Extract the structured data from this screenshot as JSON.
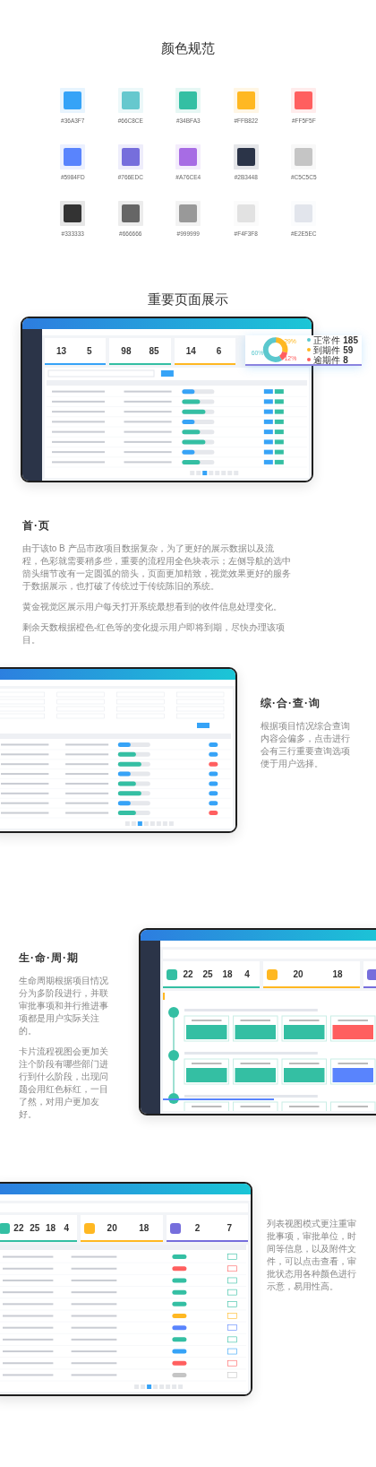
{
  "color_spec": {
    "title": "颜色规范",
    "swatches": [
      {
        "label": "#36A3F7",
        "color": "#36a3f7"
      },
      {
        "label": "#66C8CE",
        "color": "#66c8ce"
      },
      {
        "label": "#34BFA3",
        "color": "#34bfa3"
      },
      {
        "label": "#FFB822",
        "color": "#ffb822"
      },
      {
        "label": "#FF5F5F",
        "color": "#ff5f5f"
      },
      {
        "label": "#5984FD",
        "color": "#5984fd"
      },
      {
        "label": "#766EDC",
        "color": "#766edc"
      },
      {
        "label": "#A76CE4",
        "color": "#a76ce4"
      },
      {
        "label": "#2B3448",
        "color": "#2b3448"
      },
      {
        "label": "#C5C5C5",
        "color": "#c5c5c5"
      },
      {
        "label": "#333333",
        "color": "#333333"
      },
      {
        "label": "#666666",
        "color": "#666666"
      },
      {
        "label": "#999999",
        "color": "#999999"
      },
      {
        "label": "#F4F3F8",
        "color": "#e2e2e2"
      },
      {
        "label": "#E2E5EC",
        "color": "#e2e5ec"
      }
    ]
  },
  "showcase": {
    "title": "重要页面展示"
  },
  "sections": [
    {
      "kind": "dashboard",
      "heading": "首·页",
      "paragraphs": [
        "由于该to B 产品市政项目数据复杂，为了更好的展示数据以及流程，色彩就需要稍多些，重要的流程用全色块表示；左侧导航的选中箭头细节改有一定圆弧的箭头，页面更加精致，视觉效果更好的服务于数据展示，也打破了传统过于传统陈旧的系统。",
        "黄金视觉区展示用户每天打开系统最想看到的收件信息处理变化。",
        "剩余天数根据橙色-红色等的变化提示用户即将到期，尽快办理该项目。"
      ],
      "mock": {
        "stat_groups": [
          {
            "color": "#36a3f7",
            "values": [
              "13",
              "5"
            ]
          },
          {
            "color": "#34bfa3",
            "values": [
              "98",
              "85"
            ]
          },
          {
            "color": "#ffb822",
            "values": [
              "14",
              "6"
            ]
          }
        ],
        "donut": [
          {
            "label": "正常件",
            "count": "185",
            "percent": "60%",
            "color": "#5bc8ce"
          },
          {
            "label": "到期件",
            "count": "59",
            "percent": "29%",
            "color": "#ffb822"
          },
          {
            "label": "逾期件",
            "count": "8",
            "percent": "12%",
            "color": "#ff5f5f"
          }
        ]
      }
    },
    {
      "kind": "query",
      "heading": "综·合·查·询",
      "paragraphs": [
        "根据项目情况综合查询内容会偏多，点击进行会有三行重要查询选项便于用户选择。"
      ]
    },
    {
      "kind": "lifecycle",
      "heading": "生·命·周·期",
      "paragraphs": [
        "生命周期根据项目情况分为多阶段进行，并联审批事项和并行推进事项都是用户实际关注的。",
        "卡片流程视图会更加关注个阶段有哪些部门进行到什么阶段，出现问题会用红色标红，一目了然，对用户更加友好。"
      ],
      "mock": {
        "stat_groups": [
          {
            "color": "#34bfa3",
            "values": [
              "22",
              "25",
              "18",
              "4"
            ]
          },
          {
            "color": "#ffb822",
            "values": [
              "20",
              "18"
            ]
          },
          {
            "color": "#766edc"
          }
        ]
      }
    },
    {
      "kind": "list",
      "paragraphs": [
        "列表视图模式更注重审批事项，审批单位，时间等信息，以及附件文件，可以点击查看，审批状态用各种颜色进行示意，易用性高。"
      ],
      "mock": {
        "stat_groups": [
          {
            "color": "#34bfa3",
            "values": [
              "22",
              "25",
              "18",
              "4"
            ]
          },
          {
            "color": "#ffb822",
            "values": [
              "20",
              "18"
            ]
          },
          {
            "color": "#766edc",
            "values": [
              "2",
              "7"
            ]
          }
        ]
      }
    }
  ]
}
